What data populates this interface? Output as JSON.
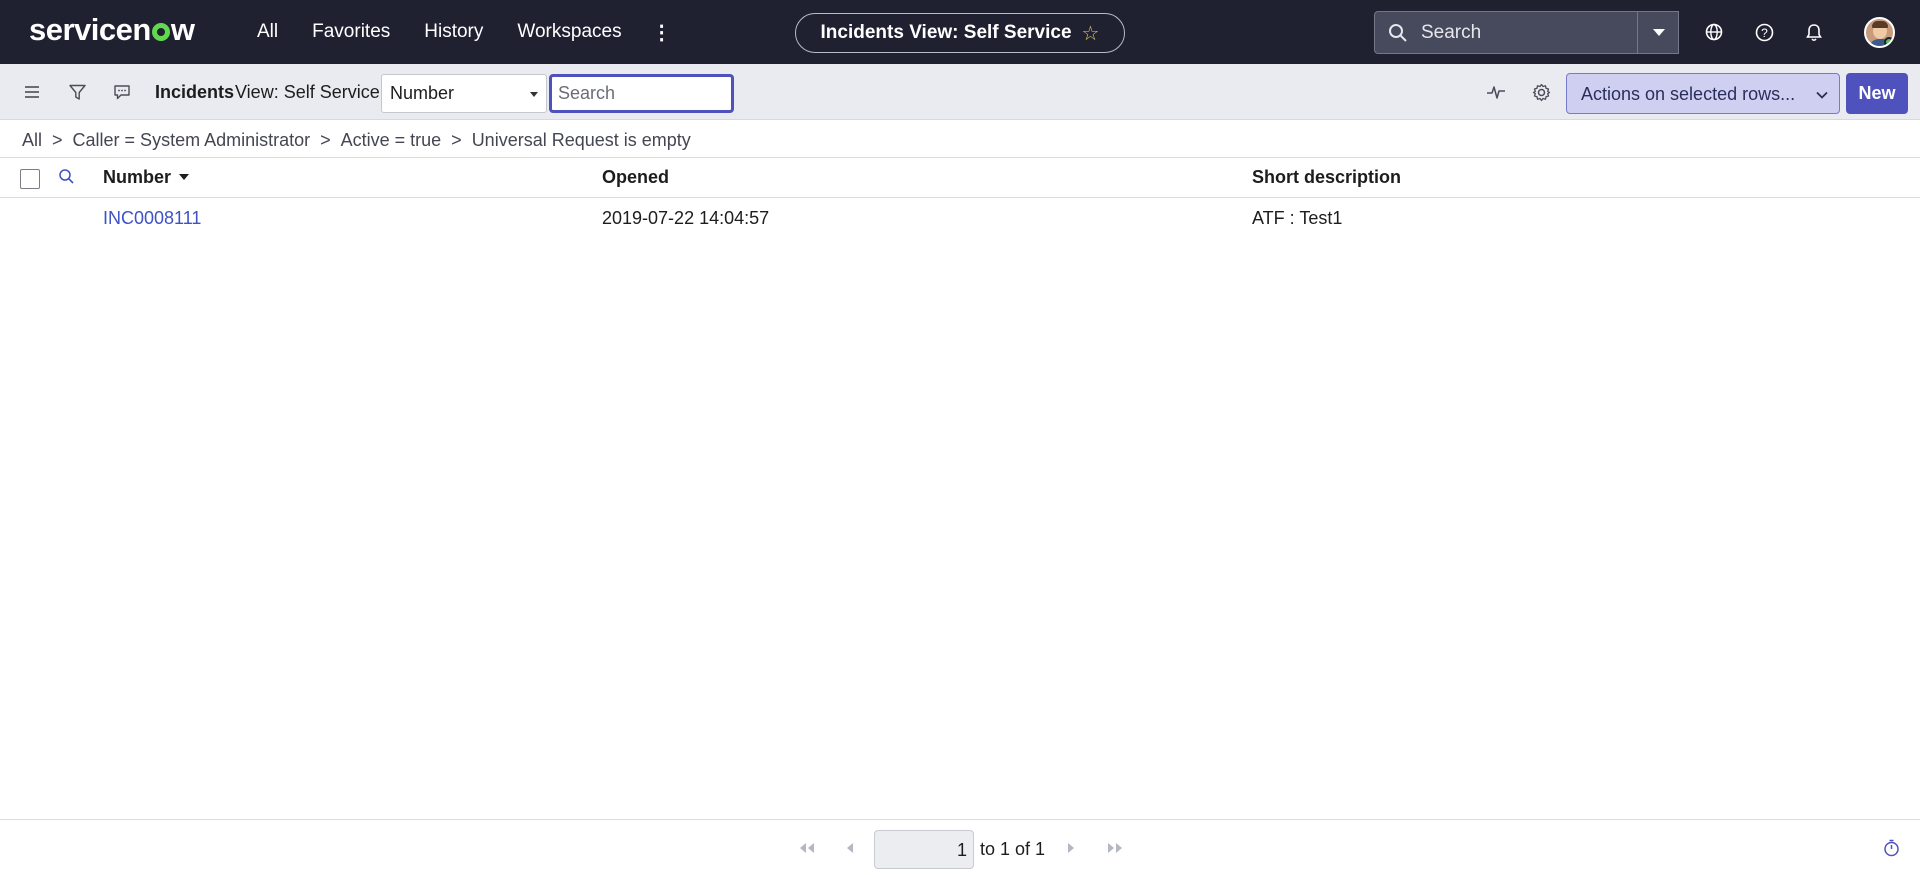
{
  "topnav": {
    "logo": "servicenow",
    "menu": [
      "All",
      "Favorites",
      "History",
      "Workspaces"
    ],
    "context_title": "Incidents View: Self Service",
    "search_placeholder": "Search"
  },
  "toolbar": {
    "list_title": "Incidents",
    "view_label": "View: Self Service",
    "search_field": "Number",
    "search_placeholder": "Search",
    "actions_label": "Actions on selected rows...",
    "new_label": "New"
  },
  "breadcrumb": [
    "All",
    "Caller = System Administrator",
    "Active = true",
    "Universal Request is empty"
  ],
  "breadcrumb_separator": ">",
  "table": {
    "columns": [
      "Number",
      "Opened",
      "Short description"
    ],
    "rows": [
      {
        "number": "INC0008111",
        "opened": "2019-07-22 14:04:57",
        "short_description": "ATF : Test1"
      }
    ]
  },
  "pagination": {
    "current": "1",
    "range_text": "to 1 of 1"
  },
  "colors": {
    "nav_bg": "#1f2030",
    "accent": "#4f52bd",
    "link": "#3e52c4",
    "logo_accent": "#62d84e"
  }
}
